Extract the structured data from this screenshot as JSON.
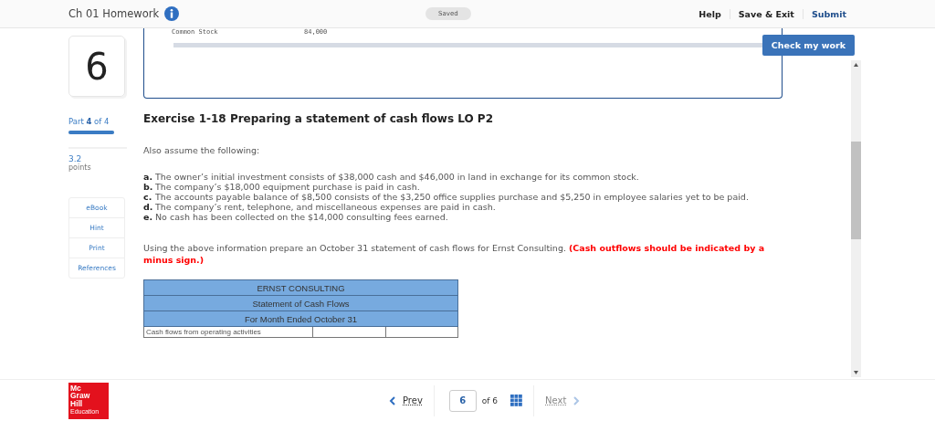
{
  "header": {
    "title": "Ch 01 Homework",
    "status": "Saved",
    "links": [
      {
        "label": "Help",
        "kind": "plain"
      },
      {
        "label": "Save & Exit",
        "kind": "plain"
      },
      {
        "label": "Submit",
        "kind": "primary"
      }
    ]
  },
  "check_button": "Check my work",
  "sidebar": {
    "question_number": "6",
    "part": "Part **4** of 4",
    "part_progress": {
      "level": 1
    },
    "points": "3.2",
    "points_label": "points",
    "tools": [
      "eBook",
      "Hint",
      "Print",
      "References"
    ]
  },
  "prior_panel": {
    "label": "Common Stock",
    "value": "84,000"
  },
  "exercise_title": "Exercise 1-18 Preparing a statement of cash flows LO P2",
  "intro": "Also assume the following:",
  "items": [
    {
      "letter": "a.",
      "text": "The owner’s initial investment consists of $38,000 cash and $46,000 in land in exchange for its common stock."
    },
    {
      "letter": "b.",
      "text": "The company’s $18,000 equipment purchase is paid in cash."
    },
    {
      "letter": "c.",
      "text": "The accounts payable balance of $8,500 consists of the $3,250 office supplies purchase and $5,250 in employee salaries yet to be paid."
    },
    {
      "letter": "d.",
      "text": "The company’s rent, telephone, and miscellaneous expenses are paid in cash."
    },
    {
      "letter": "e.",
      "text": "No cash has been collected on the $14,000 consulting fees earned."
    }
  ],
  "instruction": "Using the above information prepare an October 31 statement of cash flows for Ernst Consulting. **(Cash outflows should be indicated by a minus sign.)**",
  "statement": {
    "headings": [
      "ERNST CONSULTING",
      "Statement of Cash Flows",
      "For Month Ended October 31"
    ],
    "rows": [
      [
        "Cash flows from operating activities",
        "",
        ""
      ]
    ]
  },
  "footer": {
    "prev": "Prev",
    "page": "6",
    "of": "of 6",
    "next": "Next",
    "next_disabled": true,
    "logo": [
      "Mc",
      "Graw",
      "Hill",
      "Education"
    ]
  }
}
